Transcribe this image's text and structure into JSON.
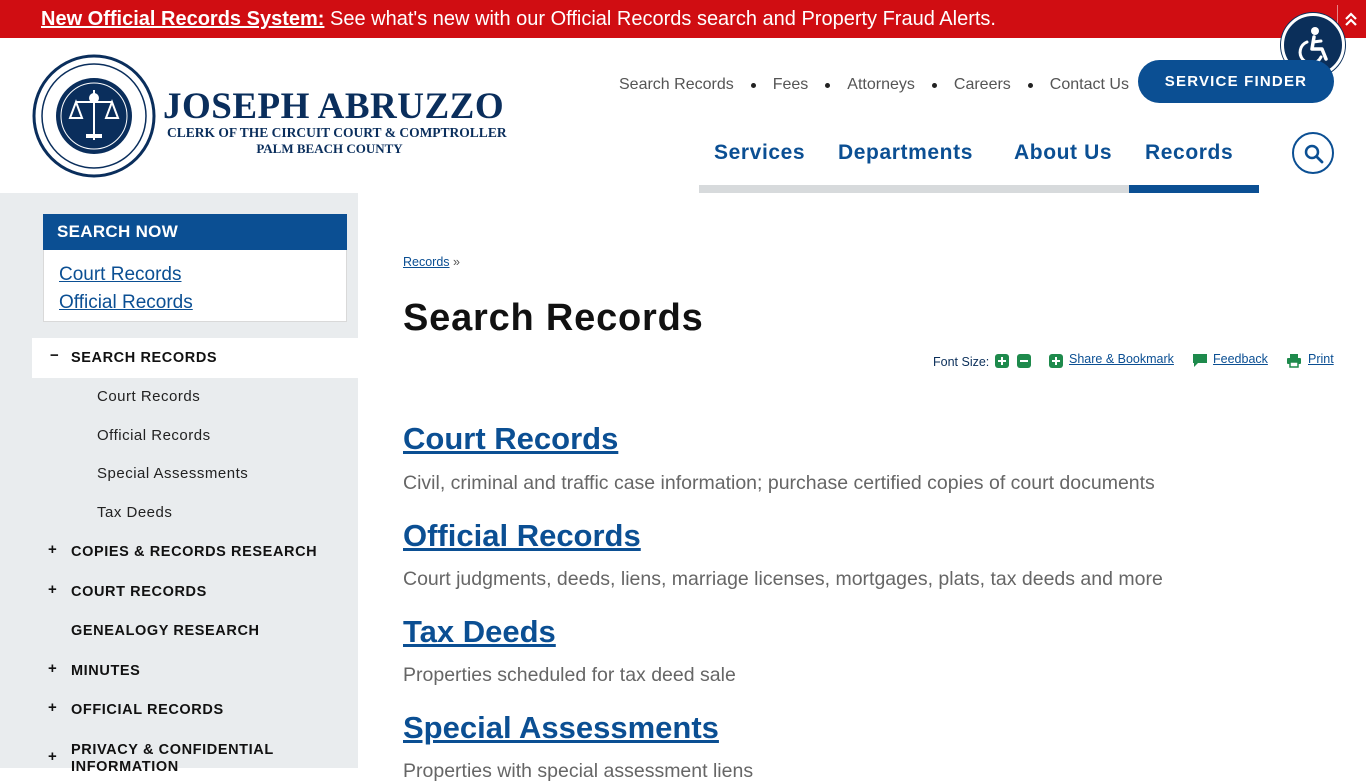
{
  "alert": {
    "link": "New Official Records System:",
    "message": " See what's new with our Official Records search and Property Fraud Alerts."
  },
  "header": {
    "name": "JOSEPH ABRUZZO",
    "title_line1": "CLERK OF THE CIRCUIT COURT & COMPTROLLER",
    "title_line2": "PALM BEACH COUNTY"
  },
  "utility_nav": [
    "Search Records",
    "Fees",
    "Attorneys",
    "Careers",
    "Contact Us"
  ],
  "service_finder": "SERVICE FINDER",
  "main_nav": [
    "Services",
    "Departments",
    "About Us",
    "Records"
  ],
  "main_nav_active": "Records",
  "sidebar": {
    "search_now": {
      "heading": "SEARCH NOW",
      "links": [
        "Court Records",
        "Official Records"
      ]
    },
    "current": {
      "sign": "−",
      "label": "SEARCH RECORDS"
    },
    "sub_items": [
      "Court Records",
      "Official Records",
      "Special Assessments",
      "Tax Deeds"
    ],
    "sections": [
      {
        "sign": "+",
        "label": "COPIES & RECORDS RESEARCH"
      },
      {
        "sign": "+",
        "label": "COURT RECORDS"
      },
      {
        "sign": "",
        "label": "GENEALOGY RESEARCH"
      },
      {
        "sign": "+",
        "label": "MINUTES"
      },
      {
        "sign": "+",
        "label": "OFFICIAL RECORDS"
      },
      {
        "sign": "+",
        "label": "PRIVACY & CONFIDENTIAL",
        "label2": "INFORMATION"
      }
    ]
  },
  "breadcrumb": {
    "link": "Records",
    "sep": " »"
  },
  "page_title": "Search Records",
  "tools": {
    "font_size_label": "Font Size:",
    "share": "Share & Bookmark",
    "feedback": "Feedback",
    "print": "Print"
  },
  "records": [
    {
      "title": "Court Records",
      "desc": "Civil, criminal and traffic case information; purchase certified copies of court documents"
    },
    {
      "title": "Official Records",
      "desc": "Court judgments, deeds, liens, marriage licenses, mortgages, plats, tax deeds and more"
    },
    {
      "title": "Tax Deeds",
      "desc": "Properties scheduled for tax deed sale"
    },
    {
      "title": "Special Assessments",
      "desc": "Properties with special assessment liens"
    }
  ],
  "colors": {
    "alert_red": "#d00d12",
    "primary_blue": "#0b4f93",
    "navy": "#0a2e5c",
    "tool_green": "#1e8a4c",
    "sidebar_bg": "#e9ecee"
  },
  "icons": [
    "accessibility-icon",
    "chevron-up-icon",
    "search-icon",
    "plus-icon",
    "minus-icon",
    "share-plus-icon",
    "feedback-icon",
    "print-icon",
    "county-seal-logo"
  ]
}
